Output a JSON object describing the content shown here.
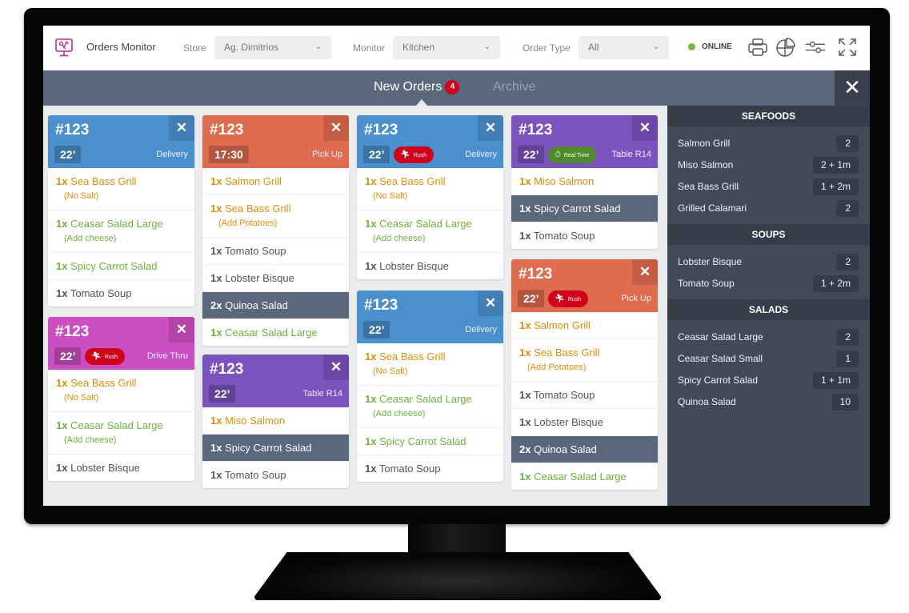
{
  "header": {
    "app_title": "Orders Monitor",
    "store_label": "Store",
    "store_value": "Ag. Dimitrios",
    "monitor_label": "Monitor",
    "monitor_value": "Kitchen",
    "order_type_label": "Order Type",
    "order_type_value": "All",
    "status": "ONLINE",
    "icons": [
      "print-icon",
      "pie-chart-icon",
      "sliders-icon",
      "fullscreen-icon"
    ]
  },
  "tabs": {
    "new_orders": "New Orders",
    "new_orders_count": "4",
    "archive": "Archive",
    "close": "✕"
  },
  "colors": {
    "delivery": "#4a90cf",
    "pickup": "#df6c4f",
    "table": "#7a53bd",
    "drive_thru": "#cc4fc1",
    "rush": "#d0021b",
    "real_time": "#4f8a2b",
    "seafood_text": "#e08e0b",
    "salad_text": "#6db33f",
    "soup_text": "#555555",
    "done_row": "#5b677b"
  },
  "orders": [
    {
      "number": "#123",
      "time": "22’",
      "type": "Delivery",
      "items": [
        {
          "qty": "1x",
          "name": "Sea Bass Grill",
          "note": "(No Salt)"
        },
        {
          "qty": "1x",
          "name": "Ceasar Salad Large",
          "note": "(Add cheese)"
        },
        {
          "qty": "1x",
          "name": "Spicy Carrot Salad"
        },
        {
          "qty": "1x",
          "name": "Tomato Soup"
        }
      ]
    },
    {
      "number": "#123",
      "time": "22’",
      "tag": "Rush",
      "type": "Drive Thru",
      "items": [
        {
          "qty": "1x",
          "name": "Sea Bass Grill",
          "note": "(No Salt)"
        },
        {
          "qty": "1x",
          "name": "Ceasar Salad Large",
          "note": "(Add cheese)"
        },
        {
          "qty": "1x",
          "name": "Lobster Bisque"
        }
      ]
    },
    {
      "number": "#123",
      "time": "17:30",
      "type": "Pick Up",
      "items": [
        {
          "qty": "1x",
          "name": "Salmon Grill"
        },
        {
          "qty": "1x",
          "name": "Sea Bass Grill",
          "note": "(Add Potatoes)"
        },
        {
          "qty": "1x",
          "name": "Tomato Soup"
        },
        {
          "qty": "1x",
          "name": "Lobster Bisque"
        },
        {
          "qty": "2x",
          "name": "Quinoa Salad"
        },
        {
          "qty": "1x",
          "name": "Ceasar Salad Large"
        }
      ]
    },
    {
      "number": "#123",
      "time": "22’",
      "type": "Table R14",
      "items": [
        {
          "qty": "1x",
          "name": "Miso Salmon"
        },
        {
          "qty": "1x",
          "name": "Spicy Carrot Salad"
        },
        {
          "qty": "1x",
          "name": "Tomato Soup"
        }
      ]
    },
    {
      "number": "#123",
      "time": "22’",
      "tag": "Rush",
      "type": "Delivery",
      "items": [
        {
          "qty": "1x",
          "name": "Sea Bass Grill",
          "note": "(No Salt)"
        },
        {
          "qty": "1x",
          "name": "Ceasar Salad Large",
          "note": "(Add cheese)"
        },
        {
          "qty": "1x",
          "name": "Lobster Bisque"
        }
      ]
    },
    {
      "number": "#123",
      "time": "22’",
      "type": "Delivery",
      "items": [
        {
          "qty": "1x",
          "name": "Sea Bass Grill",
          "note": "(No Salt)"
        },
        {
          "qty": "1x",
          "name": "Ceasar Salad Large",
          "note": "(Add cheese)"
        },
        {
          "qty": "1x",
          "name": "Spicy Carrot Salad"
        },
        {
          "qty": "1x",
          "name": "Tomato Soup"
        }
      ]
    },
    {
      "number": "#123",
      "time": "22’",
      "tag": "Real Time",
      "type": "Table R14",
      "items": [
        {
          "qty": "1x",
          "name": "Miso Salmon"
        },
        {
          "qty": "1x",
          "name": "Spicy Carrot Salad"
        },
        {
          "qty": "1x",
          "name": "Tomato Soup"
        }
      ]
    },
    {
      "number": "#123",
      "time": "22’",
      "tag": "Rush",
      "type": "Pick Up",
      "items": [
        {
          "qty": "1x",
          "name": "Salmon Grill"
        },
        {
          "qty": "1x",
          "name": "Sea Bass Grill",
          "note": "(Add Potatoes)"
        },
        {
          "qty": "1x",
          "name": "Tomato Soup"
        },
        {
          "qty": "1x",
          "name": "Lobster Bisque"
        },
        {
          "qty": "2x",
          "name": "Quinoa Salad"
        },
        {
          "qty": "1x",
          "name": "Ceasar Salad Large"
        }
      ]
    }
  ],
  "summary": [
    {
      "category": "SEAFOODS",
      "items": [
        {
          "name": "Salmon Grill",
          "count": "2"
        },
        {
          "name": "Miso Salmon",
          "count": "2 + 1m"
        },
        {
          "name": "Sea Bass Grill",
          "count": "1 + 2m"
        },
        {
          "name": "Grilled Calamari",
          "count": "2"
        }
      ]
    },
    {
      "category": "SOUPS",
      "items": [
        {
          "name": "Lobster Bisque",
          "count": "2"
        },
        {
          "name": "Tomato Soup",
          "count": "1 + 2m"
        }
      ]
    },
    {
      "category": "SALADS",
      "items": [
        {
          "name": "Ceasar Salad Large",
          "count": "2"
        },
        {
          "name": "Ceasar Salad Small",
          "count": "1"
        },
        {
          "name": "Spicy Carrot Salad",
          "count": "1 + 1m"
        },
        {
          "name": "Quinoa Salad",
          "count": "10"
        }
      ]
    }
  ]
}
